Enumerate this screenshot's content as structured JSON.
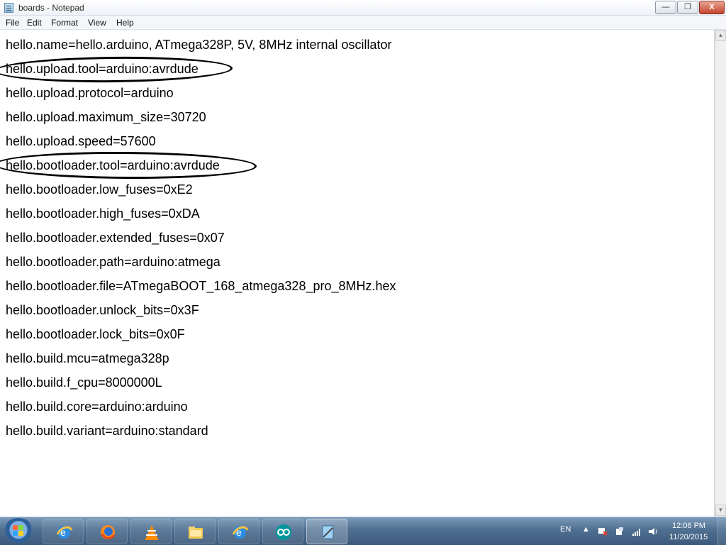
{
  "window": {
    "title": "boards - Notepad",
    "minimize_glyph": "—",
    "maximize_glyph": "❐",
    "close_glyph": "X"
  },
  "menu": [
    "File",
    "Edit",
    "Format",
    "View",
    "Help"
  ],
  "document": {
    "lines": [
      "hello.name=hello.arduino,  ATmega328P,  5V,  8MHz  internal  oscillator",
      "hello.upload.tool=arduino:avrdude",
      "hello.upload.protocol=arduino",
      "hello.upload.maximum_size=30720",
      "hello.upload.speed=57600",
      "hello.bootloader.tool=arduino:avrdude",
      "hello.bootloader.low_fuses=0xE2",
      "hello.bootloader.high_fuses=0xDA",
      "hello.bootloader.extended_fuses=0x07",
      "hello.bootloader.path=arduino:atmega",
      "hello.bootloader.file=ATmegaBOOT_168_atmega328_pro_8MHz.hex",
      "hello.bootloader.unlock_bits=0x3F",
      "hello.bootloader.lock_bits=0x0F",
      "hello.build.mcu=atmega328p",
      "hello.build.f_cpu=8000000L",
      "hello.build.core=arduino:arduino",
      "hello.build.variant=arduino:standard"
    ],
    "circled_lines": [
      1,
      5
    ]
  },
  "taskbar": {
    "icons": [
      "windows-start-icon",
      "ie-icon",
      "firefox-icon",
      "vlc-icon",
      "folder-icon",
      "ie-icon",
      "arduino-icon",
      "notepad-icon"
    ],
    "language": "EN",
    "time": "12:06 PM",
    "date": "11/20/2015"
  },
  "colors": {
    "taskbar": "#4f6f91",
    "close": "#c4452d",
    "text": "#000000"
  }
}
